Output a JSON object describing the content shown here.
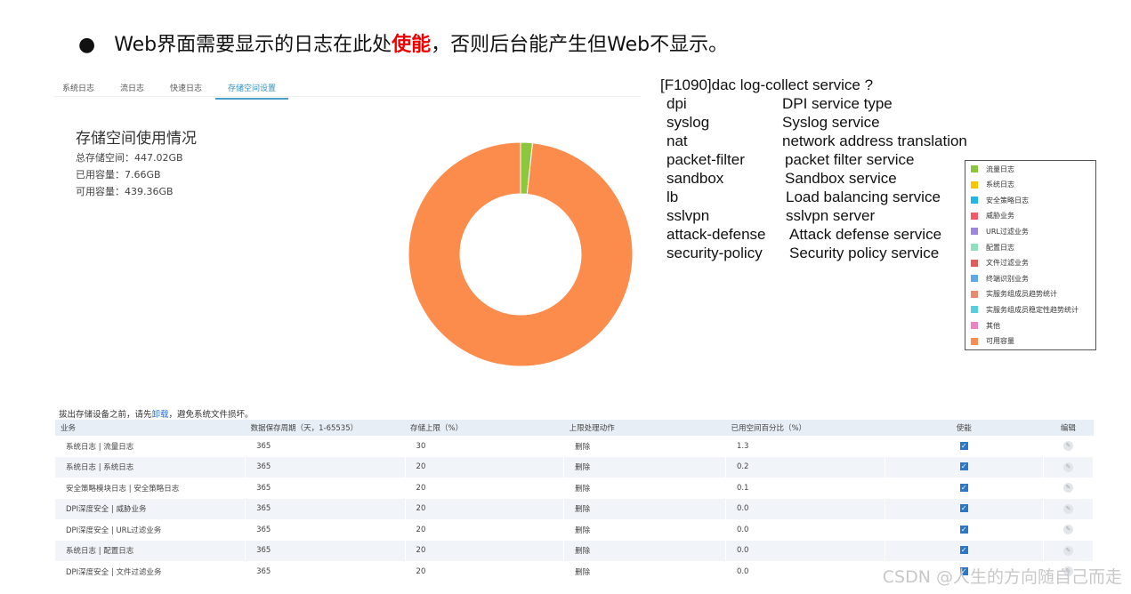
{
  "headline": {
    "pre": "Web界面需要显示的日志在此处",
    "red": "使能",
    "post": "，否则后台能产生但Web不显示。"
  },
  "tabs": [
    "系统日志",
    "流日志",
    "快速日志",
    "存储空间设置"
  ],
  "storage": {
    "title": "存储空间使用情况",
    "total": "总存储空间：447.02GB",
    "used": "已用容量：7.66GB",
    "free": "可用容量：439.36GB"
  },
  "cli": {
    "header": "[F1090]dac log-collect service ?",
    "items": [
      {
        "k": "dpi",
        "v": "DPI service type"
      },
      {
        "k": "syslog",
        "v": "Syslog service"
      },
      {
        "k": "nat",
        "v": "network address translation"
      },
      {
        "k": "packet-filter",
        "v": "packet filter service"
      },
      {
        "k": "sandbox",
        "v": "Sandbox service"
      },
      {
        "k": "lb",
        "v": "Load balancing service"
      },
      {
        "k": "sslvpn",
        "v": "sslvpn server"
      },
      {
        "k": "attack-defense",
        "v": "Attack defense service"
      },
      {
        "k": "security-policy",
        "v": "Security policy service"
      }
    ]
  },
  "chart_data": {
    "type": "pie",
    "variant": "donut",
    "series": [
      {
        "name": "流量日志",
        "value": 7.66,
        "unit": "GB",
        "color": "#8cc63f"
      },
      {
        "name": "可用容量",
        "value": 439.36,
        "unit": "GB",
        "color": "#fb8c4b"
      }
    ]
  },
  "legend": [
    {
      "label": "流量日志",
      "color": "#8cc63f"
    },
    {
      "label": "系统日志",
      "color": "#fdc400"
    },
    {
      "label": "安全策略日志",
      "color": "#1fb5e8"
    },
    {
      "label": "威胁业务",
      "color": "#f4566a"
    },
    {
      "label": "URL过滤业务",
      "color": "#9b86e0"
    },
    {
      "label": "配置日志",
      "color": "#90e0c0"
    },
    {
      "label": "文件过滤业务",
      "color": "#e35a5a"
    },
    {
      "label": "终端识别业务",
      "color": "#5ca8ea"
    },
    {
      "label": "实服务组成员趋势统计",
      "color": "#e88a6c"
    },
    {
      "label": "实服务组成员稳定性趋势统计",
      "color": "#56d0e0"
    },
    {
      "label": "其他",
      "color": "#ec82c0"
    },
    {
      "label": "可用容量",
      "color": "#fb8c4b"
    }
  ],
  "note": {
    "pre": "拔出存储设备之前，请先",
    "link": "卸载",
    "post": "，避免系统文件损坏。"
  },
  "table": {
    "headers": [
      "业务",
      "数据保存周期（天，1-65535）",
      "存储上限（%）",
      "上限处理动作",
      "已用空间百分比（%）",
      "使能",
      "编辑"
    ],
    "rows": [
      [
        "系统日志 | 流量日志",
        "365",
        "30",
        "删除",
        "1.3"
      ],
      [
        "系统日志 | 系统日志",
        "365",
        "20",
        "删除",
        "0.2"
      ],
      [
        "安全策略模块日志 | 安全策略日志",
        "365",
        "20",
        "删除",
        "0.1"
      ],
      [
        "DPI深度安全 | 威胁业务",
        "365",
        "20",
        "删除",
        "0.0"
      ],
      [
        "DPI深度安全 | URL过滤业务",
        "365",
        "20",
        "删除",
        "0.0"
      ],
      [
        "系统日志 | 配置日志",
        "365",
        "20",
        "删除",
        "0.0"
      ],
      [
        "DPI深度安全 | 文件过滤业务",
        "365",
        "20",
        "删除",
        "0.0"
      ]
    ]
  },
  "watermark": "CSDN @人生的方向随自己而走"
}
